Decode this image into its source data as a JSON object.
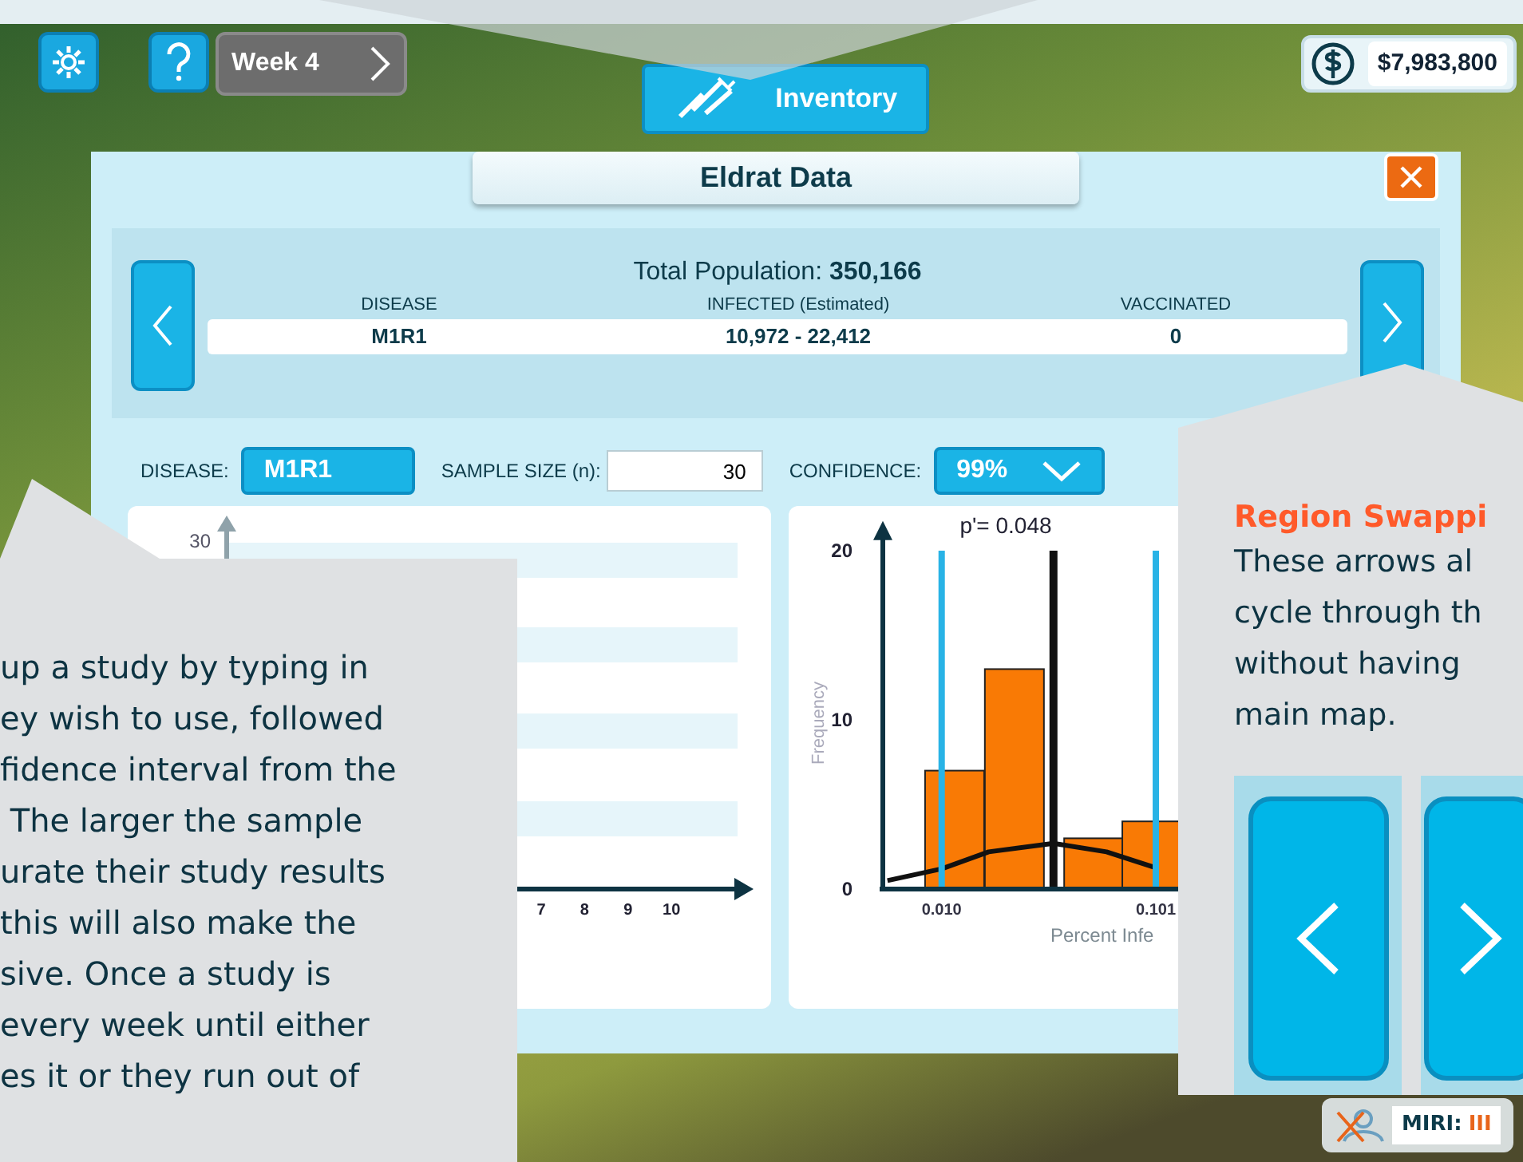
{
  "toolbar": {
    "week": "Week 4",
    "inventory": "Inventory",
    "money": "$7,983,800"
  },
  "dialog": {
    "title": "Eldrat Data",
    "population": "Total Population: **350,166**",
    "columns": [
      "DISEASE",
      "INFECTED (Estimated)",
      "VACCINATED"
    ],
    "row": [
      "M1R1",
      "10,972 - 22,412",
      "0"
    ]
  },
  "study": {
    "disease_label": "DISEASE:",
    "disease": "M1R1",
    "sample_label": "SAMPLE SIZE (n):",
    "sample": "30",
    "confidence_label": "CONFIDENCE:",
    "confidence": "99%"
  },
  "infection_chart": {
    "yticks": [
      "30"
    ],
    "xticks": [
      "7",
      "8",
      "9",
      "10"
    ]
  },
  "histogram": {
    "chart_data": {
      "type": "bar",
      "ylabel": "Frequency",
      "xlabel": "Percent Infe",
      "series": [
        {
          "color": "#f97a05",
          "x": [
            0.0155,
            0.0409,
            0.0746,
            0.0993
          ],
          "values": [
            7,
            13,
            3,
            4
          ]
        },
        {
          "type": "line",
          "color": "#111111",
          "x": [
            -0.013,
            0.01,
            0.03,
            0.0575,
            0.08,
            0.1
          ],
          "values": [
            0.5,
            1.2,
            2.2,
            2.7,
            2.2,
            1.3
          ]
        }
      ],
      "xlim": [
        -0.015,
        0.195
      ],
      "ylim": [
        0,
        21
      ],
      "yticks": [
        0,
        10,
        20
      ],
      "ref_lines": [
        {
          "axis": "x",
          "value": 0.01,
          "color": "#29b3e6"
        },
        {
          "axis": "x",
          "value": 0.0575,
          "color": "#111111"
        },
        {
          "axis": "x",
          "value": 0.101,
          "color": "#29b3e6"
        }
      ],
      "xticks": [
        {
          "value": 0.01,
          "label": "0.010"
        },
        {
          "value": 0.101,
          "label": "0.101"
        }
      ],
      "annotations": [
        "p'= 0.048"
      ]
    }
  },
  "region_badge": {
    "label": "MIRI:",
    "rank": "III"
  },
  "callouts": [
    {
      "kind": "plain",
      "lines": [
        "up a study by typing in",
        "ey wish to use, followed",
        "fidence interval from the",
        " The larger the sample",
        "urate their study results",
        "this will also make the",
        "sive. Once a study is",
        "every week until either",
        "es it or they run out of"
      ]
    },
    {
      "kind": "titled",
      "title": "Region Swappi",
      "lines": [
        "These arrows al",
        "cycle through th",
        "without having",
        "main map."
      ]
    }
  ]
}
